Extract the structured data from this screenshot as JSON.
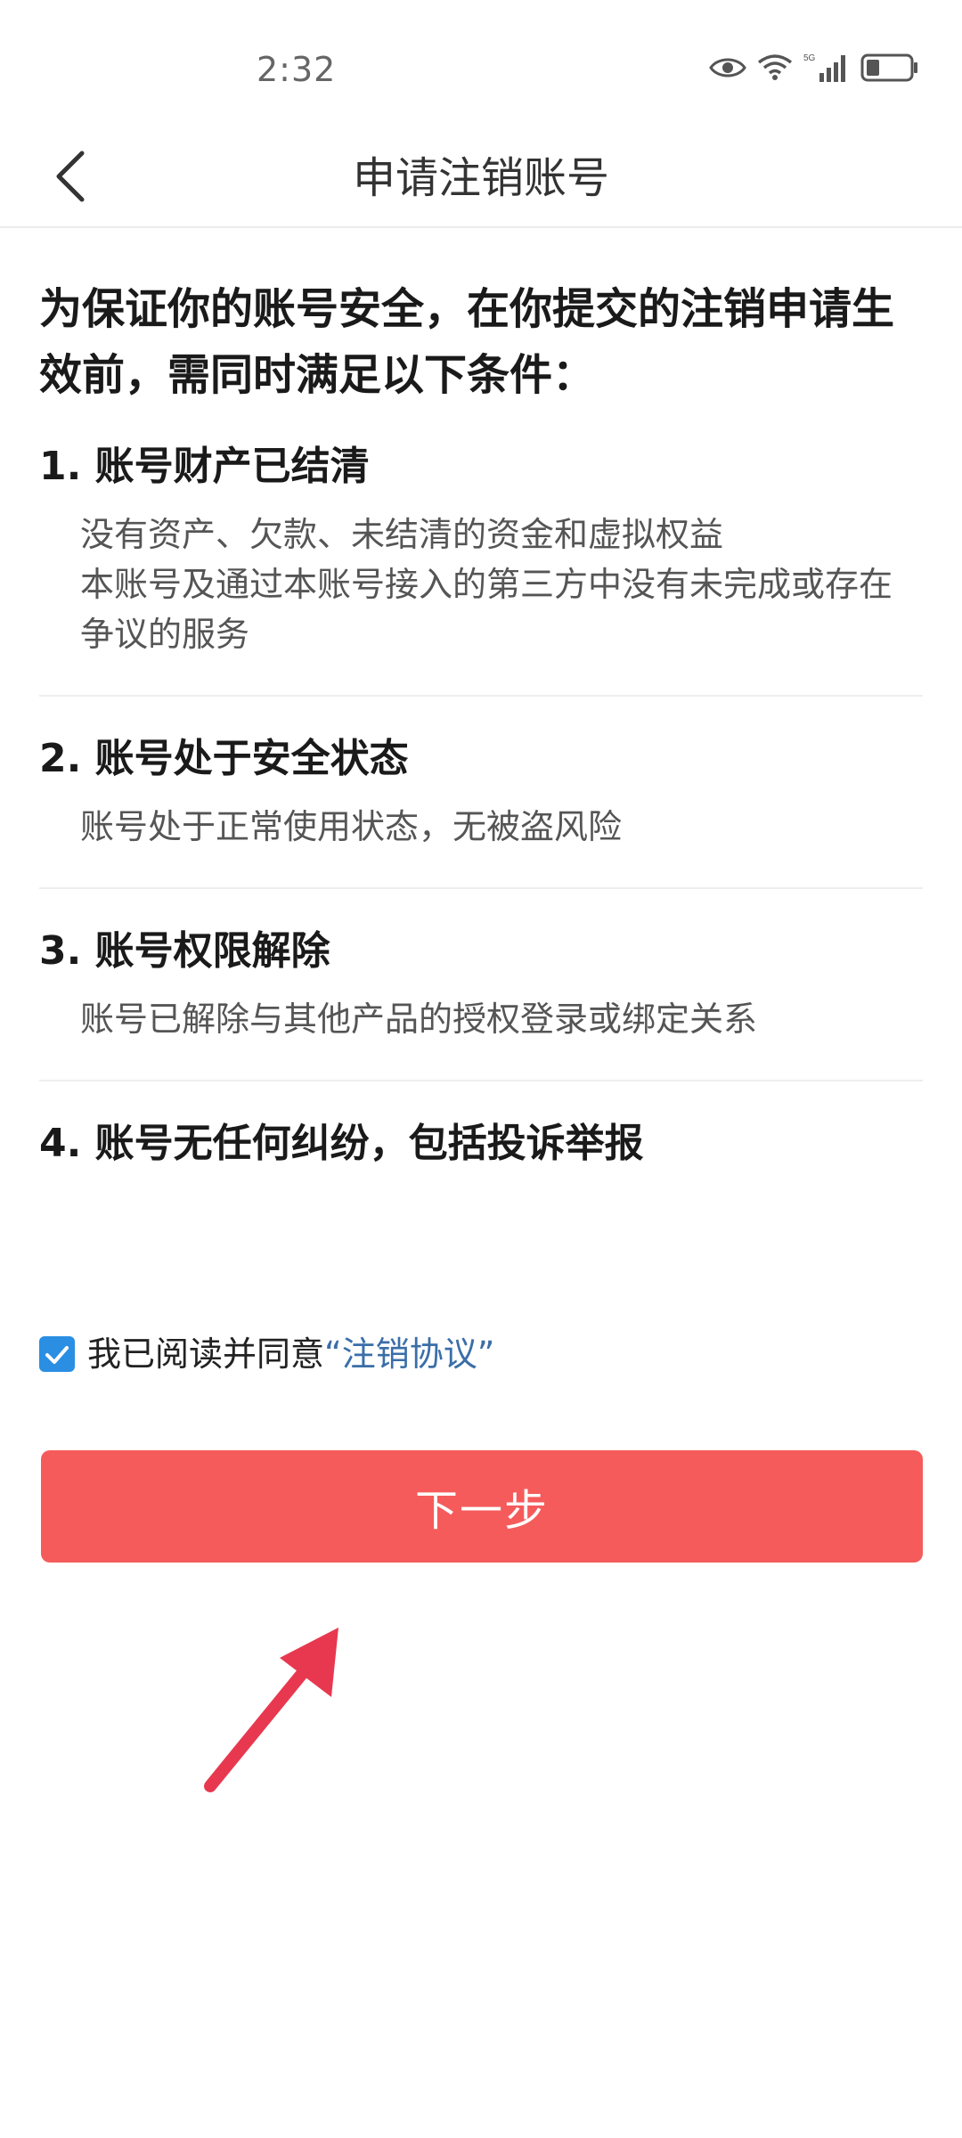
{
  "status_bar": {
    "time": "2:32",
    "icons": [
      "eye-icon",
      "wifi-icon",
      "5g-signal-icon",
      "battery-icon"
    ],
    "network_label": "5G"
  },
  "header": {
    "title": "申请注销账号",
    "back_icon": "chevron-left-icon"
  },
  "intro": "为保证你的账号安全，在你提交的注销申请生效前，需同时满足以下条件：",
  "conditions": [
    {
      "title": "1. 账号财产已结清",
      "desc": [
        "没有资产、欠款、未结清的资金和虚拟权益",
        "本账号及通过本账号接入的第三方中没有未完成或存在争议的服务"
      ]
    },
    {
      "title": "2. 账号处于安全状态",
      "desc": [
        "账号处于正常使用状态，无被盗风险"
      ]
    },
    {
      "title": "3. 账号权限解除",
      "desc": [
        "账号已解除与其他产品的授权登录或绑定关系"
      ]
    },
    {
      "title": "4. 账号无任何纠纷，包括投诉举报",
      "desc": []
    }
  ],
  "agreement": {
    "checked": true,
    "prefix": "我已阅读并同意",
    "link": "“注销协议”"
  },
  "next_button": {
    "label": "下一步"
  },
  "colors": {
    "button_bg": "#f65b5b",
    "checkbox": "#2a8ee3",
    "link": "#3a6ea8",
    "annotation_arrow": "#e8384f"
  }
}
